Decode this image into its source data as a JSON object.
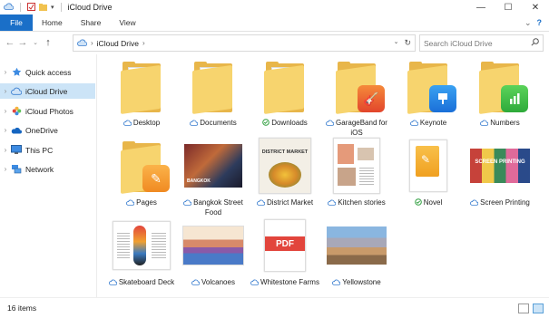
{
  "window": {
    "title": "iCloud Drive"
  },
  "ribbon": {
    "tabs": [
      "File",
      "Home",
      "Share",
      "View"
    ]
  },
  "nav": {
    "path": [
      "iCloud Drive"
    ],
    "search_placeholder": "Search iCloud Drive"
  },
  "sidebar": {
    "items": [
      {
        "label": "Quick access",
        "icon": "star-icon",
        "selected": false
      },
      {
        "label": "iCloud Drive",
        "icon": "cloud-icon",
        "selected": true
      },
      {
        "label": "iCloud Photos",
        "icon": "photos-icon",
        "selected": false
      },
      {
        "label": "OneDrive",
        "icon": "onedrive-icon",
        "selected": false
      },
      {
        "label": "This PC",
        "icon": "pc-icon",
        "selected": false
      },
      {
        "label": "Network",
        "icon": "network-icon",
        "selected": false
      }
    ]
  },
  "items": [
    {
      "label": "Desktop",
      "kind": "folder",
      "status": "cloud"
    },
    {
      "label": "Documents",
      "kind": "folder",
      "status": "cloud"
    },
    {
      "label": "Downloads",
      "kind": "folder",
      "status": "synced"
    },
    {
      "label": "GarageBand for iOS",
      "kind": "folder",
      "status": "cloud"
    },
    {
      "label": "Keynote",
      "kind": "folder",
      "status": "cloud"
    },
    {
      "label": "Numbers",
      "kind": "folder",
      "status": "cloud"
    },
    {
      "label": "Pages",
      "kind": "folder",
      "status": "cloud"
    },
    {
      "label": "Bangkok Street Food",
      "kind": "photo",
      "status": "cloud"
    },
    {
      "label": "District Market",
      "kind": "doc",
      "status": "cloud"
    },
    {
      "label": "Kitchen stories",
      "kind": "doc",
      "status": "cloud"
    },
    {
      "label": "Novel",
      "kind": "pages-doc",
      "status": "synced"
    },
    {
      "label": "Screen Printing",
      "kind": "photo",
      "status": "cloud"
    },
    {
      "label": "Skateboard Deck",
      "kind": "doc",
      "status": "cloud"
    },
    {
      "label": "Volcanoes",
      "kind": "photo",
      "status": "cloud"
    },
    {
      "label": "Whitestone Farms",
      "kind": "pdf",
      "status": "cloud"
    },
    {
      "label": "Yellowstone",
      "kind": "photo",
      "status": "cloud"
    }
  ],
  "thumb_text": {
    "pdf": "PDF",
    "district": "DISTRICT MARKET",
    "bangkok": "BANGKOK",
    "screen": "SCREEN PRINTING"
  },
  "status": {
    "count": "16 items"
  },
  "colors": {
    "accent": "#1a6fc8",
    "folder": "#f7d46e",
    "selected": "#cce4f7",
    "synced": "#2e9e3e"
  }
}
